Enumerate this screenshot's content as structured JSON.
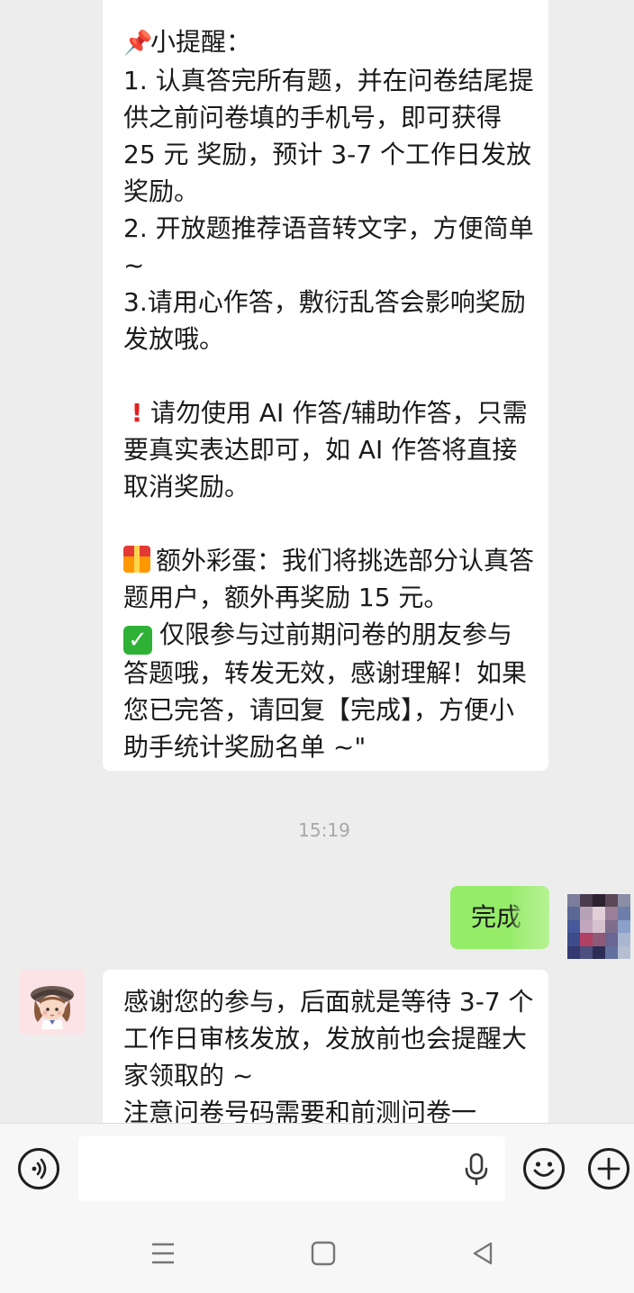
{
  "messages": {
    "received_1": {
      "line_title": "小提醒：",
      "line_1": "1. 认真答完所有题，并在问卷结尾提供之前问卷填的手机号，即可获得 25 元 奖励，预计 3-7 个工作日发放奖励。",
      "line_2": "2. 开放题推荐语音转文字，方便简单 ~",
      "line_3": "3.请用心作答，敷衍乱答会影响奖励发放哦。",
      "warning": "请勿使用 AI 作答/辅助作答，只需要真实表达即可，如 AI 作答将直接取消奖励。",
      "bonus": "额外彩蛋：我们将挑选部分认真答题用户，额外再奖励 15 元。",
      "limit": "仅限参与过前期问卷的朋友参与答题哦，转发无效，感谢理解！如果您已完答，请回复【完成】，方便小助手统计奖励名单 ~\""
    },
    "timestamp": "15:19",
    "sent_1": "完成",
    "received_2": "感谢您的参与，后面就是等待 3-7 个工作日审核发放，发放前也会提醒大家领取的 ~\n注意问卷号码需要和前测问卷一"
  },
  "icons": {
    "pin": "pushpin-icon",
    "exclamation": "red-exclamation-icon",
    "gift": "gift-icon",
    "check": "check-mark-icon",
    "voice": "voice-toggle-icon",
    "mic": "microphone-icon",
    "emoji": "emoji-icon",
    "plus": "plus-icon"
  },
  "colors": {
    "chat_background": "#ededed",
    "received_bubble": "#ffffff",
    "sent_bubble": "#95ec69",
    "timestamp_text": "#a8a8a8"
  }
}
